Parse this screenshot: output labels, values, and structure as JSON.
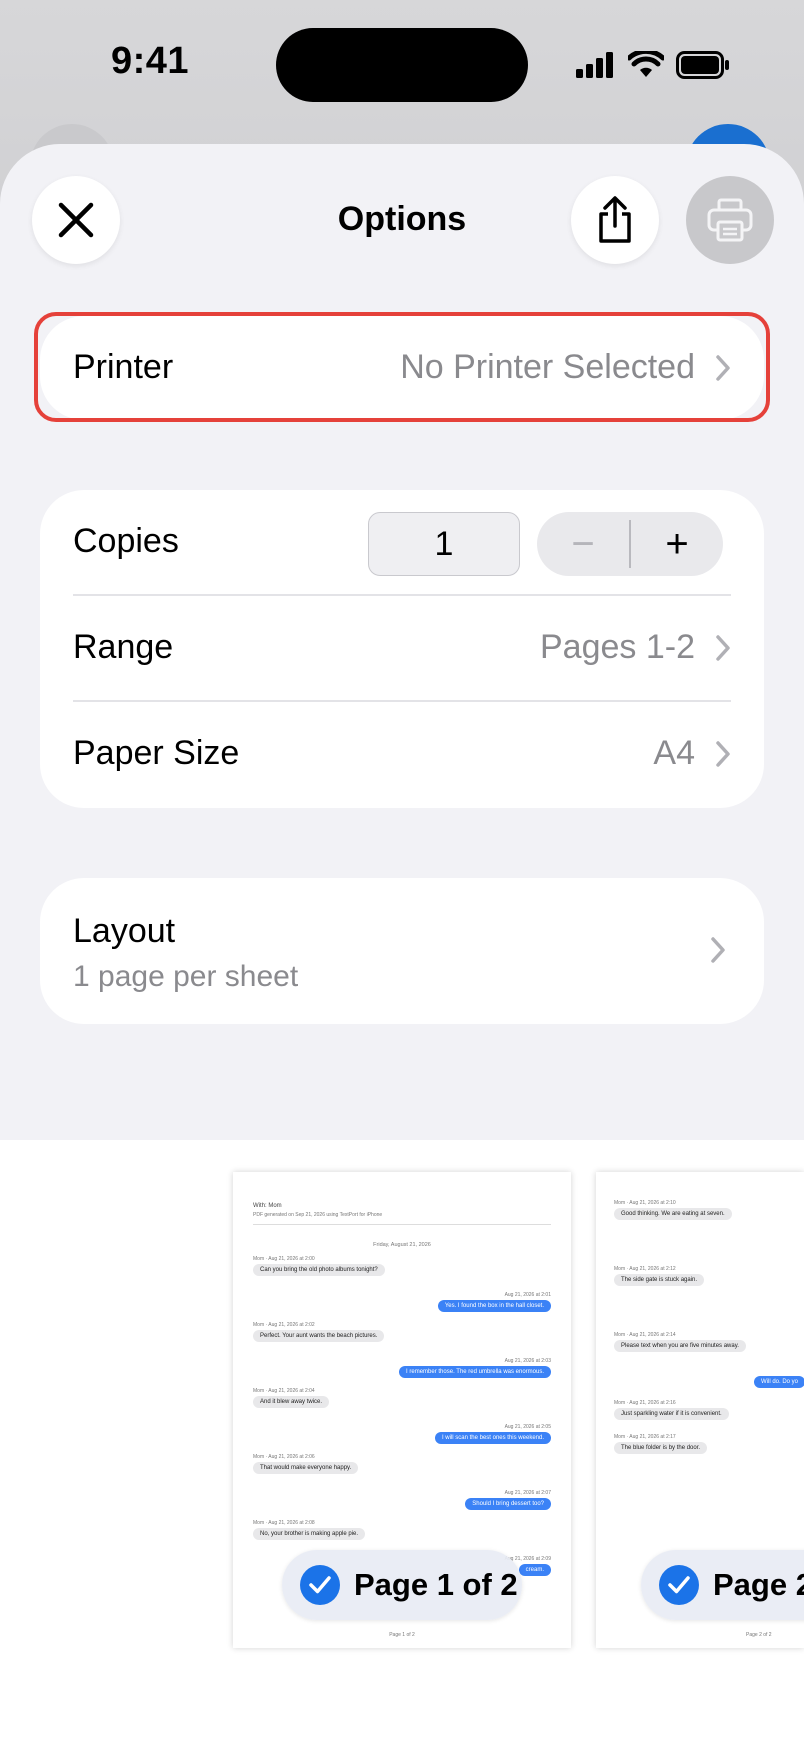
{
  "status_bar": {
    "time": "9:41"
  },
  "header": {
    "title": "Options"
  },
  "printer_row": {
    "label": "Printer",
    "value": "No Printer Selected"
  },
  "copies_row": {
    "label": "Copies",
    "value": "1",
    "decrement": "−",
    "increment": "+"
  },
  "range_row": {
    "label": "Range",
    "value": "Pages 1-2"
  },
  "paper_row": {
    "label": "Paper Size",
    "value": "A4"
  },
  "layout_row": {
    "label": "Layout",
    "value": "1 page per sheet"
  },
  "preview": {
    "page1": {
      "header_title": "With: Mom",
      "header_sub": "PDF generated on Sep 21, 2026 using TextPort for iPhone",
      "date": "Friday, August 21, 2026",
      "messages": [
        {
          "meta": "Mom · Aug 21, 2026 at 2:00",
          "text": "Can you bring the old photo albums tonight?"
        },
        {
          "meta": "Aug 21, 2026 at 2:01",
          "text": "Yes. I found the box in the hall closet."
        },
        {
          "meta": "Mom · Aug 21, 2026 at 2:02",
          "text": "Perfect. Your aunt wants the beach pictures."
        },
        {
          "meta": "Aug 21, 2026 at 2:03",
          "text": "I remember those. The red umbrella was enormous."
        },
        {
          "meta": "Mom · Aug 21, 2026 at 2:04",
          "text": "And it blew away twice."
        },
        {
          "meta": "Aug 21, 2026 at 2:05",
          "text": "I will scan the best ones this weekend."
        },
        {
          "meta": "Mom · Aug 21, 2026 at 2:06",
          "text": "That would make everyone happy."
        },
        {
          "meta": "Aug 21, 2026 at 2:07",
          "text": "Should I bring dessert too?"
        },
        {
          "meta": "Mom · Aug 21, 2026 at 2:08",
          "text": "No, your brother is making apple pie."
        },
        {
          "meta": "Aug 21, 2026 at 2:09",
          "text": "cream."
        }
      ],
      "footer": "Page 1 of 2",
      "pill_label": "Page 1 of 2"
    },
    "page2": {
      "messages": [
        {
          "meta": "Mom · Aug 21, 2026 at 2:10",
          "text": "Good thinking. We are eating at seven."
        },
        {
          "meta": "Mom · Aug 21, 2026 at 2:12",
          "text": "The side gate is stuck again."
        },
        {
          "meta": "Mom · Aug 21, 2026 at 2:14",
          "text": "Please text when you are five minutes away."
        },
        {
          "meta": "",
          "text": "Will do. Do yo"
        },
        {
          "meta": "Mom · Aug 21, 2026 at 2:16",
          "text": "Just sparkling water if it is convenient."
        },
        {
          "meta": "Mom · Aug 21, 2026 at 2:17",
          "text": "The blue folder is by the door."
        }
      ],
      "footer": "Page 2 of 2",
      "pill_label": "Page 2"
    }
  },
  "colors": {
    "highlight": "#e5413a",
    "accent": "#1b73e8",
    "outgoing_bubble": "#3b82f6"
  }
}
